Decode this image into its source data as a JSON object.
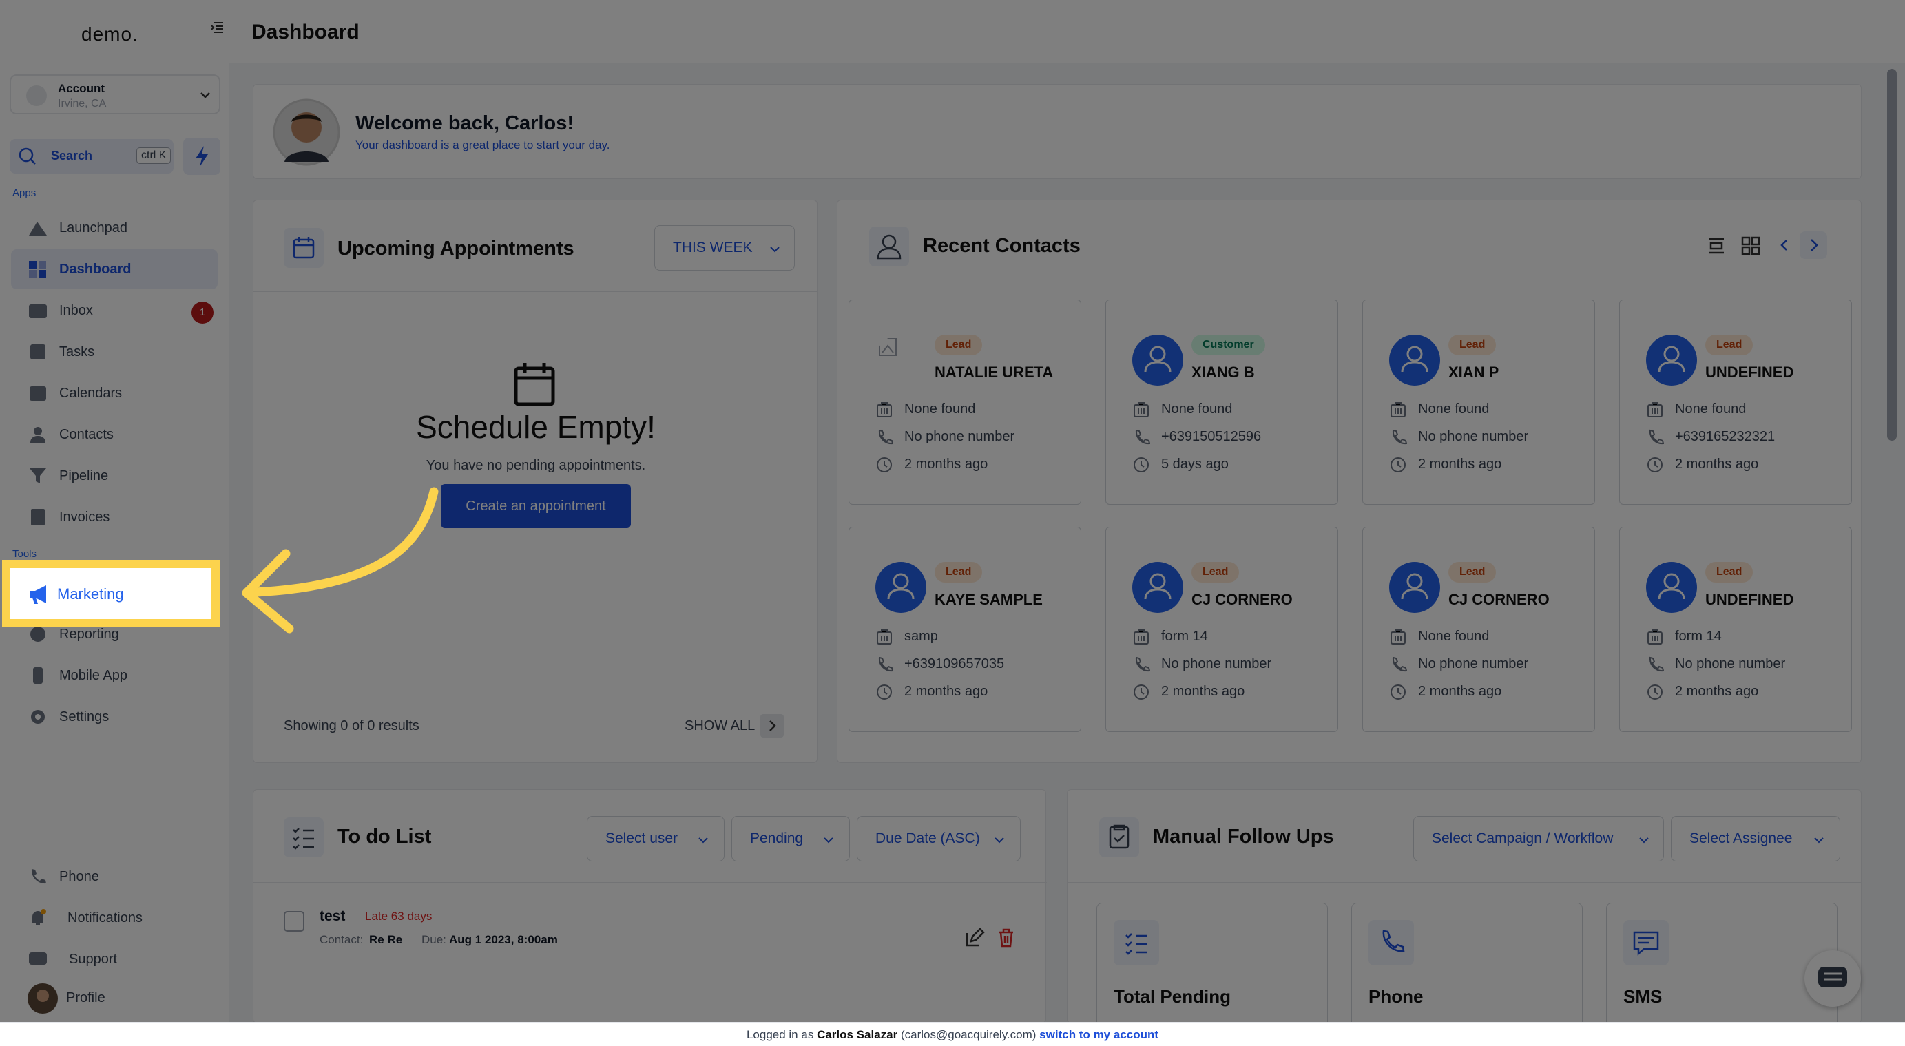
{
  "sidebar": {
    "logo": "demo.",
    "account": {
      "name": "Account",
      "location": "Irvine, CA"
    },
    "search": {
      "label": "Search",
      "shortcut": "ctrl K"
    },
    "apps_label": "Apps",
    "tools_label": "Tools",
    "apps": [
      {
        "label": "Launchpad"
      },
      {
        "label": "Dashboard"
      },
      {
        "label": "Inbox",
        "badge": "1"
      },
      {
        "label": "Tasks"
      },
      {
        "label": "Calendars"
      },
      {
        "label": "Contacts"
      },
      {
        "label": "Pipeline"
      },
      {
        "label": "Invoices"
      }
    ],
    "tools": [
      {
        "label": "Marketing"
      },
      {
        "label": "Reporting"
      },
      {
        "label": "Mobile App"
      },
      {
        "label": "Settings"
      }
    ],
    "bottom": [
      {
        "label": "Phone"
      },
      {
        "label": "Notifications"
      },
      {
        "label": "Support"
      },
      {
        "label": "Profile"
      }
    ]
  },
  "header": {
    "title": "Dashboard"
  },
  "welcome": {
    "title": "Welcome back, Carlos!",
    "subtitle": "Your dashboard is a great place to start your day."
  },
  "appointments": {
    "title": "Upcoming Appointments",
    "range": "THIS WEEK",
    "empty_title": "Schedule Empty!",
    "empty_text": "You have no pending appointments.",
    "create_button": "Create an appointment",
    "results": "Showing 0 of 0 results",
    "show_all": "SHOW ALL"
  },
  "recent_contacts": {
    "title": "Recent Contacts",
    "contacts": [
      {
        "tag": "Lead",
        "name": "NATALIE URETA",
        "company": "None found",
        "phone": "No phone number",
        "time": "2 months ago"
      },
      {
        "tag": "Customer",
        "name": "XIANG B",
        "company": "None found",
        "phone": "+639150512596",
        "time": "5 days ago"
      },
      {
        "tag": "Lead",
        "name": "XIAN P",
        "company": "None found",
        "phone": "No phone number",
        "time": "2 months ago"
      },
      {
        "tag": "Lead",
        "name": "UNDEFINED",
        "company": "None found",
        "phone": "+639165232321",
        "time": "2 months ago"
      },
      {
        "tag": "Lead",
        "name": "KAYE SAMPLE",
        "company": "samp",
        "phone": "+639109657035",
        "time": "2 months ago"
      },
      {
        "tag": "Lead",
        "name": "CJ CORNERO",
        "company": "form 14",
        "phone": "No phone number",
        "time": "2 months ago"
      },
      {
        "tag": "Lead",
        "name": "CJ CORNERO",
        "company": "None found",
        "phone": "No phone number",
        "time": "2 months ago"
      },
      {
        "tag": "Lead",
        "name": "UNDEFINED",
        "company": "form 14",
        "phone": "No phone number",
        "time": "2 months ago"
      }
    ]
  },
  "todo": {
    "title": "To do List",
    "filters": [
      "Select user",
      "Pending",
      "Due Date (ASC)"
    ],
    "task": {
      "name": "test",
      "late": "Late 63 days",
      "contact_label": "Contact:",
      "contact": "Re Re",
      "due_label": "Due:",
      "due": "Aug 1 2023, 8:00am"
    }
  },
  "followups": {
    "title": "Manual Follow Ups",
    "filters": [
      "Select Campaign / Workflow",
      "Select Assignee"
    ],
    "cards": [
      "Total Pending",
      "Phone",
      "SMS"
    ]
  },
  "footer": {
    "prefix": "Logged in as",
    "user": "Carlos Salazar",
    "email": "(carlos@goacquirely.com)",
    "switch": "switch to my account"
  },
  "colors": {
    "accent": "#1d4ed8",
    "highlight": "#fcd34d",
    "badge": "#b91c1c"
  }
}
